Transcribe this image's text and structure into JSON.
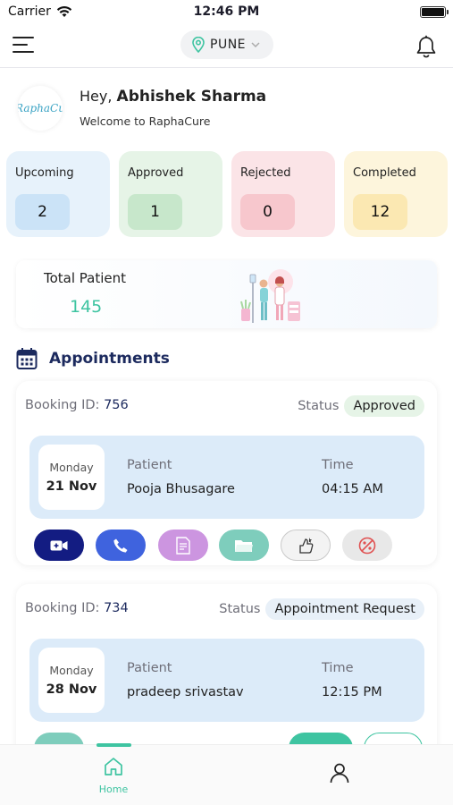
{
  "status_bar": {
    "carrier": "Carrier",
    "time": "12:46 PM"
  },
  "nav": {
    "city": "PUNE"
  },
  "greeting": {
    "hey": "Hey,",
    "name": "Abhishek Sharma",
    "welcome": "Welcome to RaphaCure",
    "logo_text": "RaphaCu"
  },
  "stats": [
    {
      "label": "Upcoming",
      "count": "2"
    },
    {
      "label": "Approved",
      "count": "1"
    },
    {
      "label": "Rejected",
      "count": "0"
    },
    {
      "label": "Completed",
      "count": "12"
    }
  ],
  "total_patient": {
    "label": "Total Patient",
    "value": "145"
  },
  "appointments": {
    "title": "Appointments",
    "items": [
      {
        "booking_label": "Booking ID:",
        "booking_id": "756",
        "status_label": "Status",
        "status": "Approved",
        "day": "Monday",
        "date": "21 Nov",
        "patient_label": "Patient",
        "patient": "Pooja Bhusagare",
        "time_label": "Time",
        "time": "04:15 AM"
      },
      {
        "booking_label": "Booking ID:",
        "booking_id": "734",
        "status_label": "Status",
        "status": "Appointment Request",
        "day": "Monday",
        "date": "28 Nov",
        "patient_label": "Patient",
        "patient": "pradeep srivastav",
        "time_label": "Time",
        "time": "12:15 PM"
      }
    ]
  },
  "tab_bar": {
    "home_label": "Home"
  },
  "colors": {
    "accent_green": "#3ec4a1",
    "navy": "#1c2a5e",
    "video_button": "#131c82",
    "call_button": "#3f63de"
  },
  "icons": [
    "wifi-icon",
    "battery-icon",
    "menu-icon",
    "location-pin-icon",
    "chevron-down-icon",
    "bell-icon",
    "calendar-icon",
    "video-icon",
    "phone-icon",
    "report-icon",
    "folder-icon",
    "review-icon",
    "cancel-icon",
    "home-icon",
    "user-icon"
  ]
}
